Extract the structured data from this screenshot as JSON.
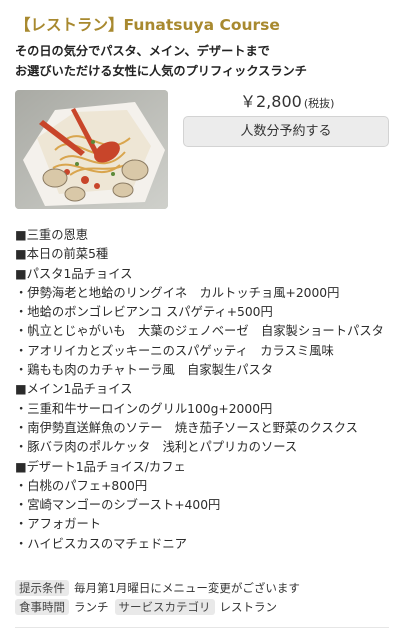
{
  "course": {
    "title": "【レストラン】Funatsuya Course",
    "subtitle_line1": "その日の気分でパスタ、メイン、デザートまで",
    "subtitle_line2": "お選びいただける女性に人気のプリフィックスランチ",
    "price": "￥2,800",
    "tax_note": "(税抜)",
    "reserve_label": "人数分予約する"
  },
  "menu_lines": [
    "■三重の恩恵",
    "■本日の前菜5種",
    "■パスタ1品チョイス",
    "・伊勢海老と地蛤のリングイネ　カルトッチョ風+2000円",
    "・地蛤のボンゴレビアンコ スパゲティ+500円",
    "・帆立とじゃがいも　大葉のジェノベーゼ　自家製ショートパスタ",
    "・アオリイカとズッキーニのスパゲッティ　カラスミ風味",
    "・鶏もも肉のカチャトーラ風　自家製生パスタ",
    "■メイン1品チョイス",
    "・三重和牛サーロインのグリル100g+2000円",
    "・南伊勢直送鮮魚のソテー　焼き茄子ソースと野菜のクスクス",
    "・豚バラ肉のポルケッタ　浅利とパプリカのソース",
    "■デザート1品チョイス/カフェ",
    "・白桃のパフェ+800円",
    "・宮崎マンゴーのシブースト+400円",
    "・アフォガート",
    "・ハイビスカスのマチェドニア"
  ],
  "meta": {
    "condition_label": "提示条件",
    "condition_value": "毎月第1月曜日にメニュー変更がございます",
    "mealtime_label": "食事時間",
    "mealtime_value": "ランチ",
    "category_label": "サービスカテゴリ",
    "category_value": "レストラン"
  }
}
